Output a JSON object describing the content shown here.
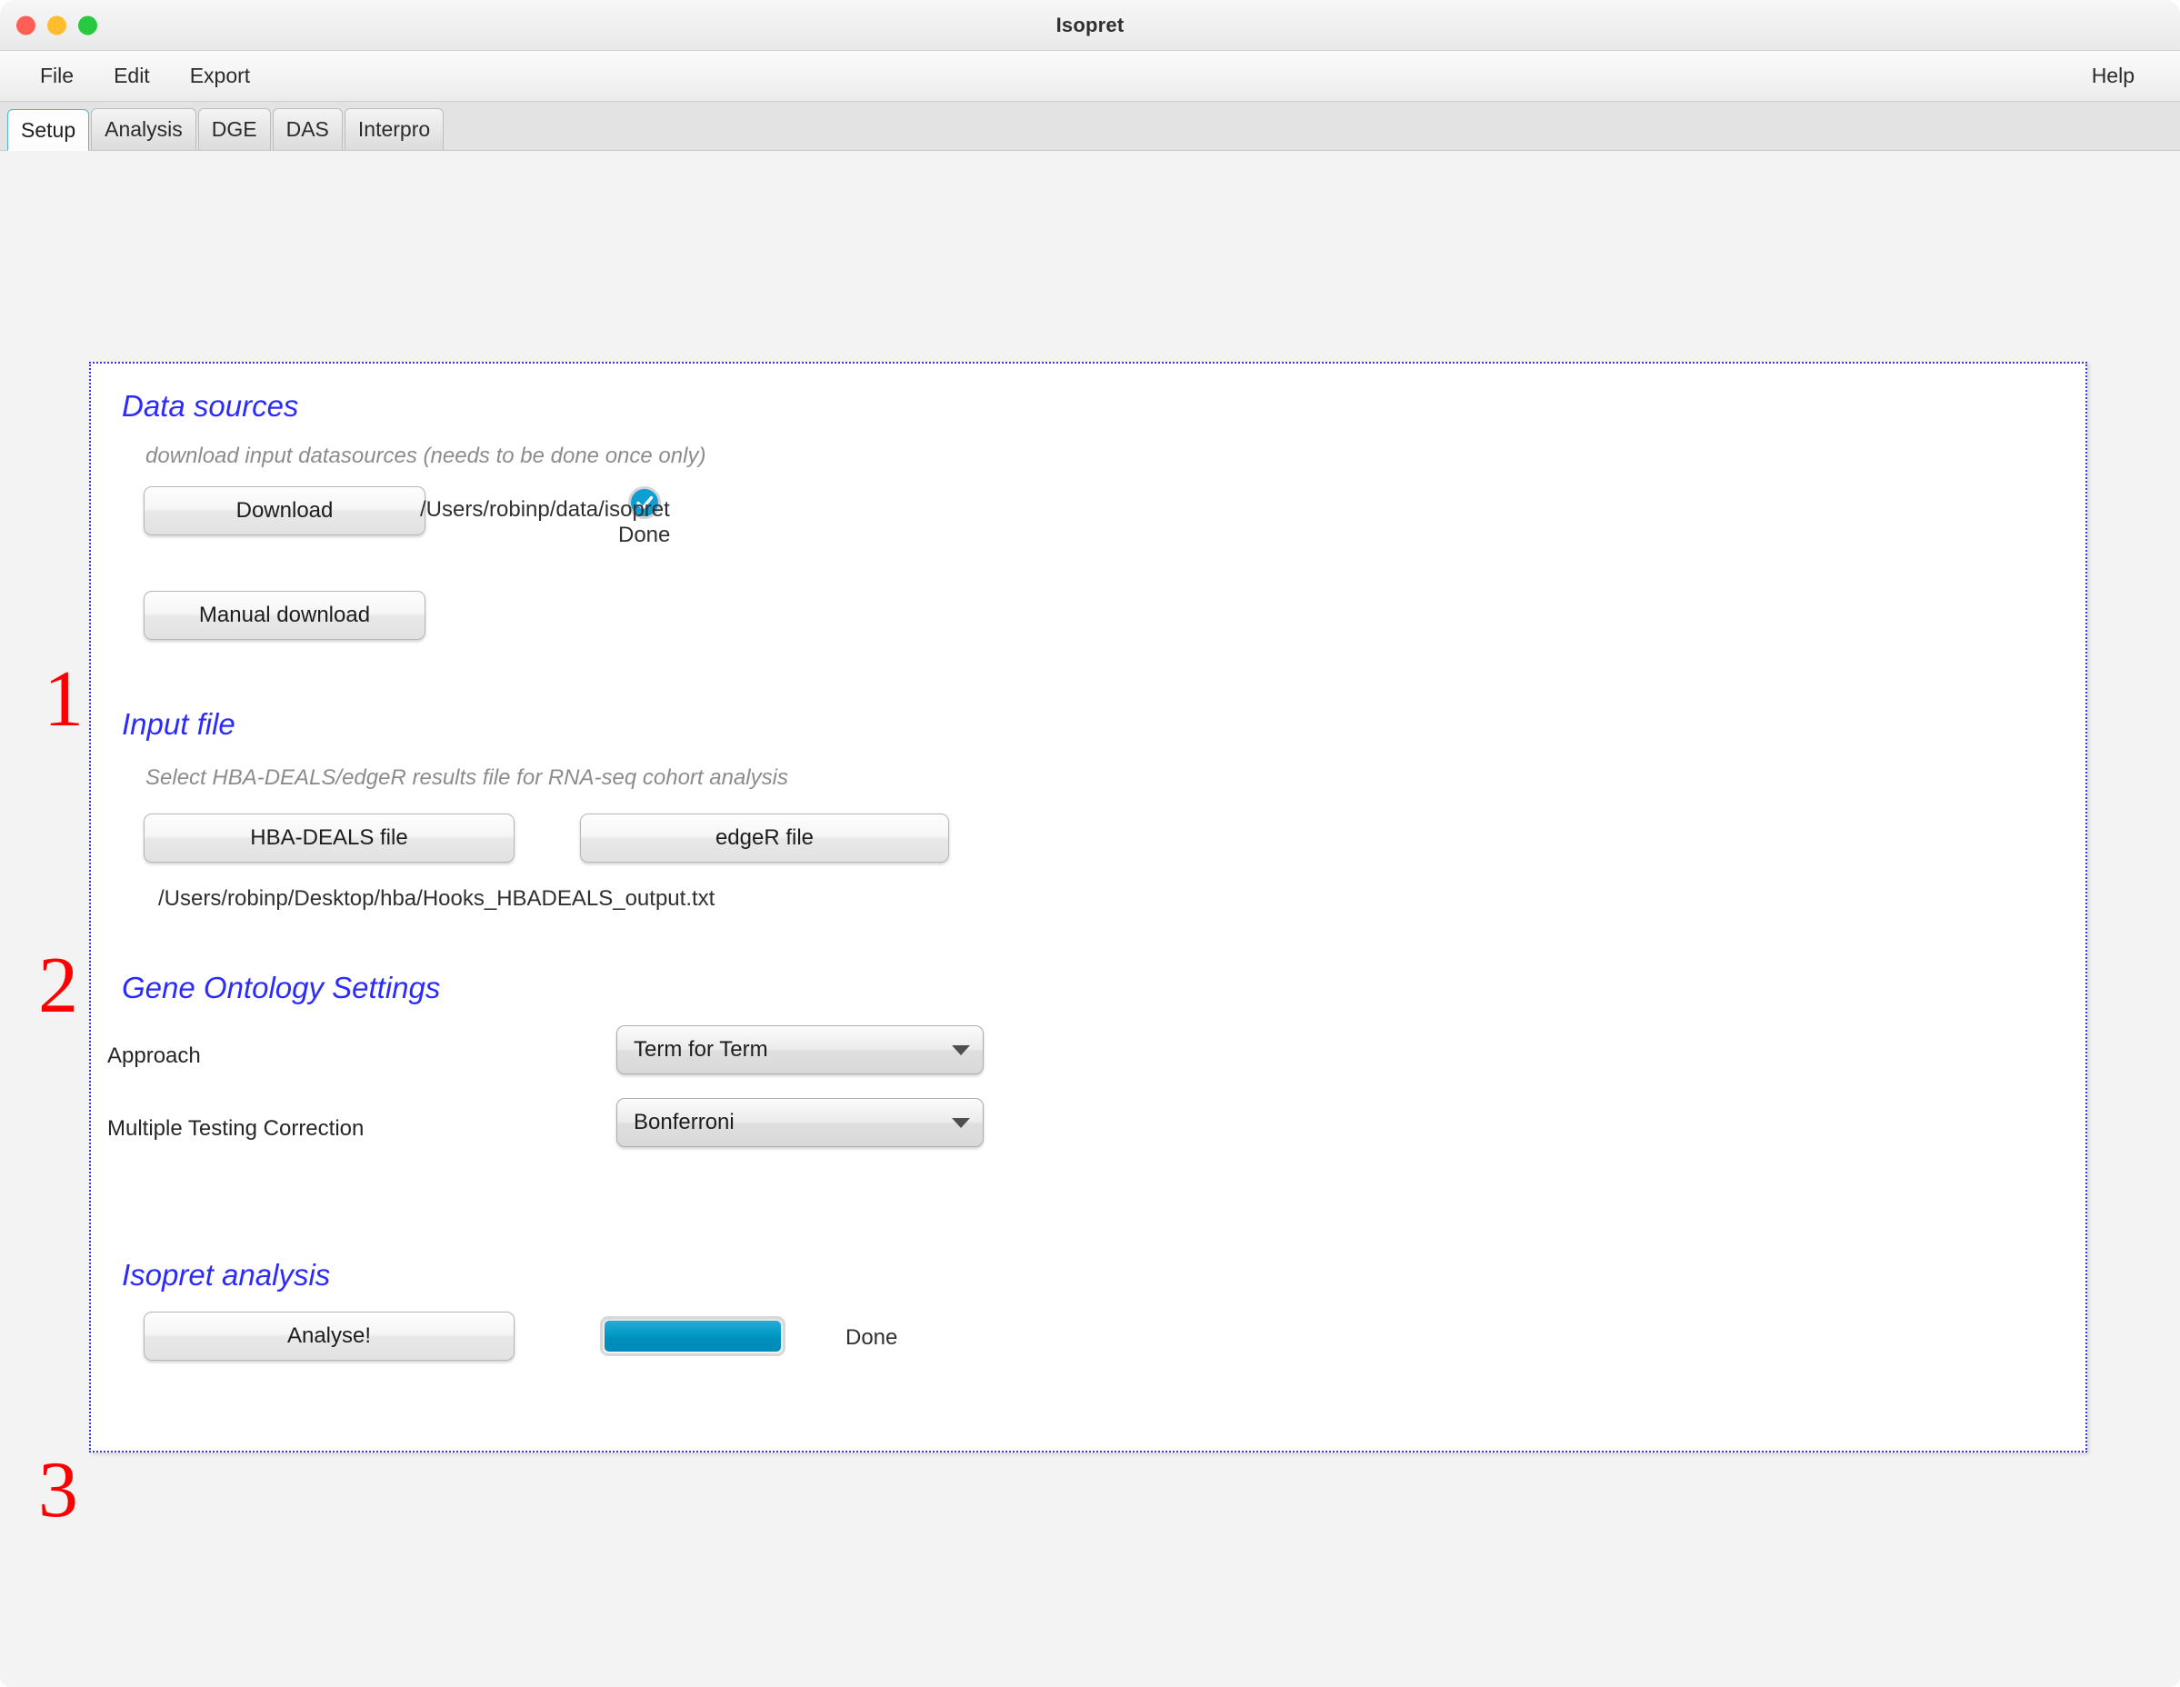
{
  "window": {
    "title": "Isopret",
    "traffic_lights": [
      "close",
      "minimize",
      "zoom"
    ]
  },
  "menubar": {
    "items": [
      "File",
      "Edit",
      "Export"
    ],
    "help": "Help"
  },
  "tabs": [
    {
      "label": "Setup",
      "active": true
    },
    {
      "label": "Analysis",
      "active": false
    },
    {
      "label": "DGE",
      "active": false
    },
    {
      "label": "DAS",
      "active": false
    },
    {
      "label": "Interpro",
      "active": false
    }
  ],
  "steps": {
    "one": "1",
    "two": "2",
    "three": "3"
  },
  "data_sources": {
    "heading": "Data sources",
    "subtitle": "download input datasources (needs to be done once only)",
    "download_button": "Download",
    "manual_download_button": "Manual download",
    "status_label": "Done",
    "status_icon": "check-circle-icon",
    "path": "/Users/robinp/data/isopret"
  },
  "input_file": {
    "heading": "Input file",
    "subtitle": "Select HBA-DEALS/edgeR results file for RNA-seq cohort analysis",
    "hbadeals_button": "HBA-DEALS file",
    "edger_button": "edgeR file",
    "selected_path": "/Users/robinp/Desktop/hba/Hooks_HBADEALS_output.txt"
  },
  "go_settings": {
    "heading": "Gene Ontology Settings",
    "approach_label": "Approach",
    "approach_value": "Term for Term",
    "correction_label": "Multiple Testing Correction",
    "correction_value": "Bonferroni"
  },
  "analysis": {
    "heading": "Isopret analysis",
    "analyse_button": "Analyse!",
    "progress_percent": 100,
    "status_text": "Done"
  },
  "colors": {
    "heading_blue": "#2b2bff",
    "step_red": "#ff0000",
    "panel_border": "#3a36d8",
    "accent_blue": "#009bc9",
    "active_tab_border": "#4ab6e8"
  }
}
